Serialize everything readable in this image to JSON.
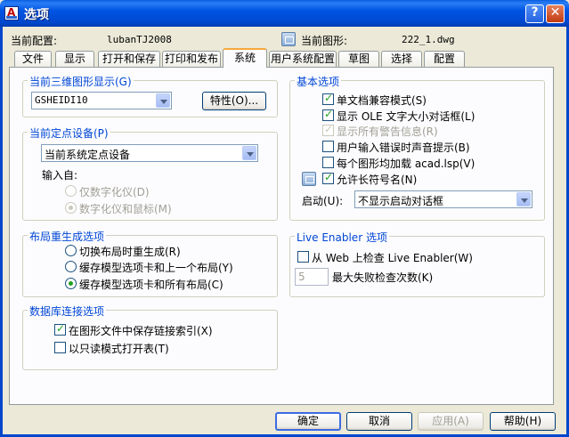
{
  "window": {
    "title": "选项"
  },
  "header": {
    "profile_label": "当前配置:",
    "profile_value": "lubanTJ2008",
    "drawing_label": "当前图形:",
    "drawing_value": "222_1.dwg"
  },
  "tabs": [
    "文件",
    "显示",
    "打开和保存",
    "打印和发布",
    "系统",
    "用户系统配置",
    "草图",
    "选择",
    "配置"
  ],
  "active_tab": "系统",
  "graphics": {
    "title": "当前三维图形显示(G)",
    "combo_value": "GSHEIDI10",
    "props_button": "特性(O)..."
  },
  "pointing": {
    "title": "当前定点设备(P)",
    "combo_value": "当前系统定点设备",
    "accept_label": "输入自:",
    "opt_digitizer": "仅数字化仪(D)",
    "opt_both": "数字化仪和鼠标(M)"
  },
  "layout_regen": {
    "title": "布局重生成选项",
    "opt1": "切换布局时重生成(R)",
    "opt2": "缓存模型选项卡和上一个布局(Y)",
    "opt3": "缓存模型选项卡和所有布局(C)"
  },
  "dbconn": {
    "title": "数据库连接选项",
    "opt1": "在图形文件中保存链接索引(X)",
    "opt2": "以只读模式打开表(T)"
  },
  "general": {
    "title": "基本选项",
    "opt1": "单文档兼容模式(S)",
    "opt2": "显示 OLE 文字大小对话框(L)",
    "opt3": "显示所有警告信息(R)",
    "opt4": "用户输入错误时声音提示(B)",
    "opt5": "每个图形均加载 acad.lsp(V)",
    "opt6": "允许长符号名(N)",
    "startup_label": "启动(U):",
    "startup_value": "不显示启动对话框"
  },
  "live_enabler": {
    "title": "Live Enabler 选项",
    "opt1": "从 Web 上检查 Live Enabler(W)",
    "spin_value": "5",
    "spin_label": "最大失败检查次数(K)"
  },
  "buttons": {
    "ok": "确定",
    "cancel": "取消",
    "apply": "应用(A)",
    "help": "帮助(H)"
  },
  "colors": {
    "titlebar": "#0054e3",
    "group_title": "#0046d5",
    "face": "#ece9d8"
  }
}
